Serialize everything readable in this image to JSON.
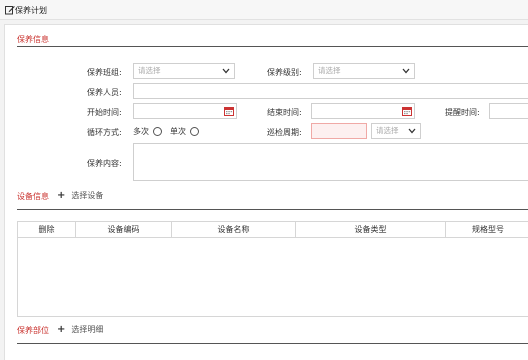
{
  "window": {
    "title": "保养计划"
  },
  "sections": {
    "info": {
      "title": "保养信息"
    },
    "equipment": {
      "title": "设备信息",
      "add_label": "选择设备"
    },
    "parts": {
      "title": "保养部位",
      "add_label": "选择明细"
    }
  },
  "form": {
    "team": {
      "label": "保养班组:",
      "placeholder": "请选择"
    },
    "level": {
      "label": "保养级别:",
      "placeholder": "请选择"
    },
    "personnel": {
      "label": "保养人员:"
    },
    "start_time": {
      "label": "开始时间:"
    },
    "end_time": {
      "label": "结束时间:"
    },
    "remind_time": {
      "label": "提醒时间:"
    },
    "cycle_mode": {
      "label": "循环方式:",
      "options": [
        "多次",
        "单次"
      ]
    },
    "patrol_cycle": {
      "label": "巡检周期:",
      "placeholder": "请选择"
    },
    "content": {
      "label": "保养内容:"
    }
  },
  "equipment_table": {
    "columns": [
      "删除",
      "设备编码",
      "设备名称",
      "设备类型",
      "规格型号"
    ]
  },
  "colors": {
    "section_title": "#c9302c",
    "error_field_bg": "#fdf0f0"
  }
}
